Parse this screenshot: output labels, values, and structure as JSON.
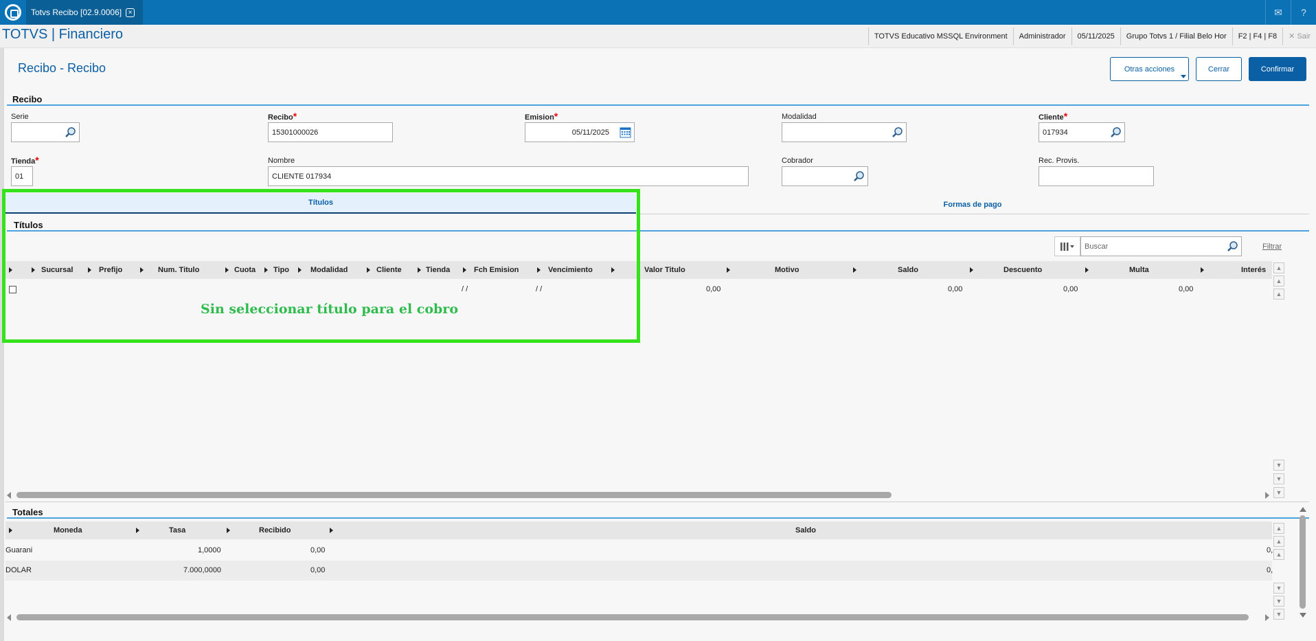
{
  "topbar": {
    "tab_title": "Totvs Recibo [02.9.0006]",
    "icons": [
      "mail-icon",
      "help-icon"
    ]
  },
  "header": {
    "app_title": "TOTVS | Financiero",
    "environment": "TOTVS Educativo MSSQL Environment",
    "user": "Administrador",
    "date": "05/11/2025",
    "branch": "Grupo Totvs 1 / Filial Belo Hor",
    "shortcuts": "F2 | F4 | F8",
    "exit": "Sair"
  },
  "page": {
    "title": "Recibo - Recibo",
    "buttons": {
      "other_actions": "Otras acciones",
      "close": "Cerrar",
      "confirm": "Confirmar"
    }
  },
  "recibo": {
    "section_title": "Recibo",
    "fields": {
      "serie": {
        "label": "Serie",
        "value": ""
      },
      "recibo": {
        "label": "Recibo",
        "value": "15301000026"
      },
      "emision": {
        "label": "Emision",
        "value": "05/11/2025"
      },
      "modalidad": {
        "label": "Modalidad",
        "value": ""
      },
      "cliente": {
        "label": "Cliente",
        "value": "017934"
      },
      "tienda": {
        "label": "Tienda",
        "value": "01"
      },
      "nombre": {
        "label": "Nombre",
        "value": "CLIENTE 017934"
      },
      "cobrador": {
        "label": "Cobrador",
        "value": ""
      },
      "rec_provis": {
        "label": "Rec. Provis.",
        "value": ""
      }
    }
  },
  "folders": {
    "titulos": "Títulos",
    "formas_pago": "Formas de pago"
  },
  "titulos": {
    "section_title": "Títulos",
    "search_placeholder": "Buscar",
    "filter_label": "Filtrar",
    "columns": [
      "Sucursal",
      "Prefijo",
      "Num. Titulo",
      "Cuota",
      "Tipo",
      "Modalidad",
      "Cliente",
      "Tienda",
      "Fch Emision",
      "Vencimiento",
      "Valor Titulo",
      "Motivo",
      "Saldo",
      "Descuento",
      "Multa",
      "Interés"
    ],
    "row": {
      "fch_emision": "/ /",
      "vencimiento": "/ /",
      "valor_titulo": "0,00",
      "saldo": "0,00",
      "descuento": "0,00",
      "multa": "0,00"
    }
  },
  "annotation": "Sin seleccionar título para el cobro",
  "totales": {
    "section_title": "Totales",
    "columns": [
      "Moneda",
      "Tasa",
      "Recibido",
      "Saldo"
    ],
    "rows": [
      {
        "moneda": "Guarani",
        "tasa": "1,0000",
        "recibido": "0,00",
        "saldo": "0,"
      },
      {
        "moneda": "DOLAR",
        "tasa": "7.000,0000",
        "recibido": "0,00",
        "saldo": "0,"
      }
    ]
  },
  "colors": {
    "primary": "#0b5fa5",
    "topbar": "#0b72b5",
    "highlight": "#35e21b",
    "annotation": "#2fbb4e",
    "required": "#e00000"
  }
}
